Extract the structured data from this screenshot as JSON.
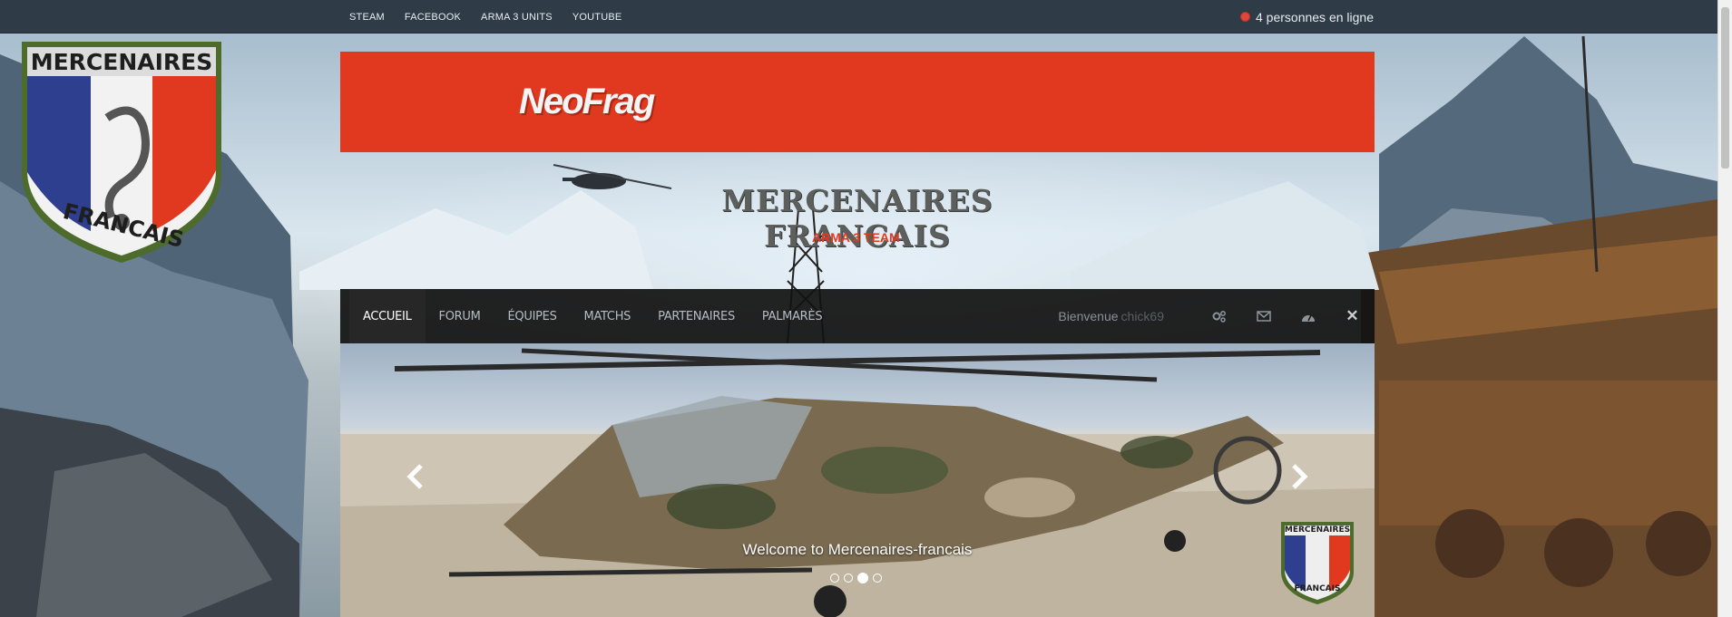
{
  "topbar": {
    "links": [
      "STEAM",
      "FACEBOOK",
      "ARMA 3 UNITS",
      "YOUTUBE"
    ],
    "online_text": "4 personnes en ligne",
    "online_icon": "globe-icon"
  },
  "emblem": {
    "top_text": "MERCENAIRES",
    "bottom_text": "FRANCAIS"
  },
  "banner": {
    "logo_text": "NeoFrag",
    "color": "#e0391f"
  },
  "header": {
    "title": "MERCENAIRES FRANCAIS",
    "subtitle": "ARMA 3 TEAM"
  },
  "nav": {
    "items": [
      {
        "label": "ACCUEIL",
        "active": true
      },
      {
        "label": "FORUM",
        "active": false
      },
      {
        "label": "ÉQUIPES",
        "active": false
      },
      {
        "label": "MATCHS",
        "active": false
      },
      {
        "label": "PARTENAIRES",
        "active": false
      },
      {
        "label": "PALMARÈS",
        "active": false
      }
    ],
    "welcome_label": "Bienvenue",
    "username": "chick69",
    "icons": [
      "settings-icon",
      "mail-icon",
      "dashboard-icon",
      "close-icon"
    ]
  },
  "carousel": {
    "caption": "Welcome to Mercenaires-francais",
    "slide_count": 4,
    "active_index": 2,
    "emblem_top_text": "MERCENAIRES",
    "emblem_bottom_text": "FRANCAIS"
  }
}
